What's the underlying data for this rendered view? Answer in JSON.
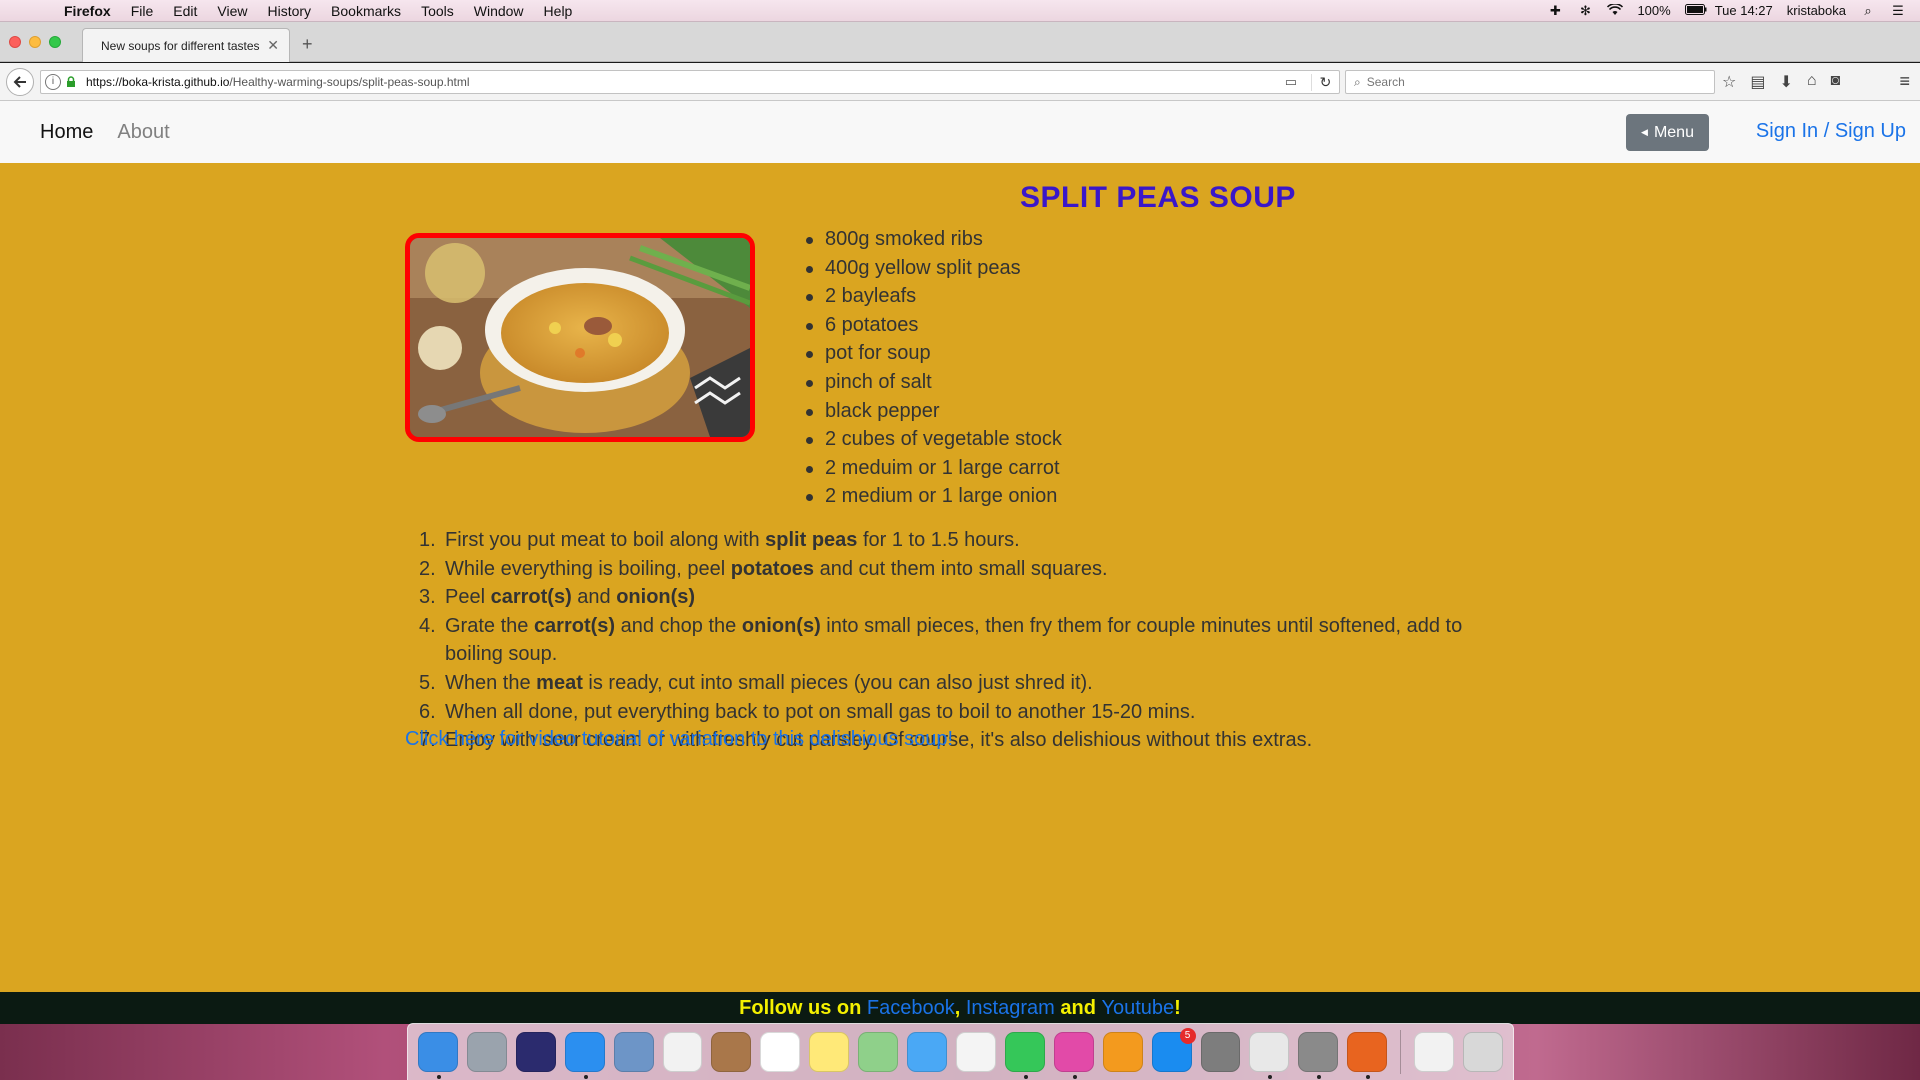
{
  "menubar": {
    "app": "Firefox",
    "items": [
      "File",
      "Edit",
      "View",
      "History",
      "Bookmarks",
      "Tools",
      "Window",
      "Help"
    ],
    "battery": "100%",
    "clock": "Tue 14:27",
    "user": "kristaboka"
  },
  "browser": {
    "tab_title": "New soups for different tastes",
    "url_base": "https://boka-krista.github.io",
    "url_path": "/Healthy-warming-soups/split-peas-soup.html",
    "search_placeholder": "Search"
  },
  "site": {
    "nav": {
      "home": "Home",
      "about": "About",
      "menu_button": "Menu",
      "sign": "Sign In / Sign Up"
    },
    "title": "SPLIT PEAS SOUP",
    "ingredients": [
      "800g smoked ribs",
      "400g yellow split peas",
      "2 bayleafs",
      "6 potatoes",
      "pot for soup",
      "pinch of salt",
      "black pepper",
      "2 cubes of vegetable stock",
      "2 meduim or 1 large carrot",
      "2 medium or 1 large onion"
    ],
    "steps": [
      {
        "a": "First you put meat to boil along with ",
        "b": "split peas",
        "c": " for 1 to 1.5 hours.",
        "d": "",
        "e": ""
      },
      {
        "a": "While everything is boiling, peel ",
        "b": "potatoes",
        "c": " and cut them into small squares.",
        "d": "",
        "e": ""
      },
      {
        "a": "Peel ",
        "b": "carrot(s)",
        "c": " and ",
        "d": "onion(s)",
        "e": ""
      },
      {
        "a": "Grate the ",
        "b": "carrot(s)",
        "c": " and chop the ",
        "d": "onion(s)",
        "e": " into small pieces, then fry them for couple minutes until softened, add to boiling soup."
      },
      {
        "a": "When the ",
        "b": "meat",
        "c": " is ready, cut into small pieces (you can also just shred it).",
        "d": "",
        "e": ""
      },
      {
        "a": "When all done, put everything back to pot on small gas to boil to another 15-20 mins.",
        "b": "",
        "c": "",
        "d": "",
        "e": ""
      },
      {
        "a": "Enjoy with sour cream or with freshly cut parsley. Of course, it's also delishious without this extras.",
        "b": "",
        "c": "",
        "d": "",
        "e": ""
      }
    ],
    "video_link": "Click here for video tutorial of variation to this delishious soup!",
    "footer": {
      "prefix": "Follow us on ",
      "facebook": "Facebook",
      "sep1": ", ",
      "instagram": "Instagram",
      "sep2": " and ",
      "youtube": "Youtube",
      "suffix": "!"
    }
  },
  "dock": {
    "apps": [
      {
        "name": "finder",
        "color": "#3a8ee6",
        "running": true
      },
      {
        "name": "launchpad",
        "color": "#9aa3ad",
        "running": false
      },
      {
        "name": "siri",
        "color": "#2b2b6e",
        "running": false
      },
      {
        "name": "safari",
        "color": "#2b8ff0",
        "running": true
      },
      {
        "name": "preview",
        "color": "#6d95c7",
        "running": false
      },
      {
        "name": "reminders",
        "color": "#f2f2f2",
        "running": false
      },
      {
        "name": "notebook",
        "color": "#a9774a",
        "running": false
      },
      {
        "name": "calendar",
        "color": "#ffffff",
        "running": false
      },
      {
        "name": "notes",
        "color": "#ffe978",
        "running": false
      },
      {
        "name": "maps",
        "color": "#8fd08a",
        "running": false
      },
      {
        "name": "messages",
        "color": "#4aa8f5",
        "running": false
      },
      {
        "name": "photos",
        "color": "#f4f4f4",
        "running": false
      },
      {
        "name": "facetime",
        "color": "#35c759",
        "running": true
      },
      {
        "name": "itunes",
        "color": "#e24aa8",
        "running": true
      },
      {
        "name": "ibooks",
        "color": "#f39a1e",
        "running": false
      },
      {
        "name": "app-store",
        "color": "#1a8cf0",
        "running": false,
        "badge": "5"
      },
      {
        "name": "system-preferences",
        "color": "#7d7d7d",
        "running": false
      },
      {
        "name": "chrome",
        "color": "#e8e8e8",
        "running": true
      },
      {
        "name": "terminal-tool",
        "color": "#8a8a8a",
        "running": true
      },
      {
        "name": "firefox",
        "color": "#e8641f",
        "running": true
      }
    ],
    "trailing": [
      {
        "name": "folder-stack",
        "color": "#f2f2f2"
      },
      {
        "name": "trash",
        "color": "#d8d8d8"
      }
    ]
  }
}
